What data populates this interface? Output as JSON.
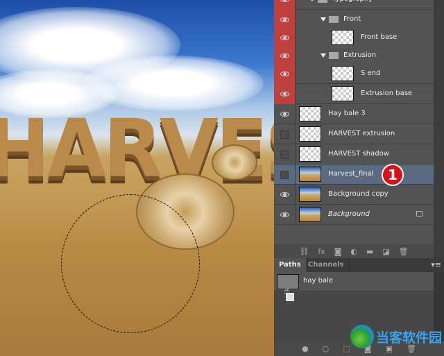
{
  "canvas": {
    "word": "HARVEST"
  },
  "layers": [
    {
      "name": "Typography",
      "type": "group",
      "visible": true,
      "highlight": "red",
      "indent": 1
    },
    {
      "name": "Front",
      "type": "group",
      "visible": true,
      "highlight": "red",
      "indent": 2
    },
    {
      "name": "Front base",
      "type": "layer",
      "visible": true,
      "highlight": "red",
      "indent": 3,
      "thumb": "transparent"
    },
    {
      "name": "Extrusion",
      "type": "group",
      "visible": true,
      "highlight": "red",
      "indent": 2
    },
    {
      "name": "S end",
      "type": "layer",
      "visible": true,
      "highlight": "red",
      "indent": 3,
      "thumb": "transparent"
    },
    {
      "name": "Extrusion base",
      "type": "layer",
      "visible": true,
      "highlight": "red",
      "indent": 3,
      "thumb": "transparent"
    },
    {
      "name": "Hay bale 3",
      "type": "layer",
      "visible": true,
      "indent": 0,
      "thumb": "transparent"
    },
    {
      "name": "HARVEST extrusion",
      "type": "layer",
      "visible": false,
      "indent": 0,
      "thumb": "transparent"
    },
    {
      "name": "HARVEST shadow",
      "type": "layer",
      "visible": false,
      "indent": 0,
      "thumb": "transparent"
    },
    {
      "name": "Harvest_final",
      "type": "smart",
      "visible": false,
      "indent": 0,
      "thumb": "photo",
      "selected": true
    },
    {
      "name": "Background copy",
      "type": "layer",
      "visible": true,
      "indent": 0,
      "thumb": "photo"
    },
    {
      "name": "Background",
      "type": "layer",
      "visible": true,
      "indent": 0,
      "thumb": "photo",
      "locked": true,
      "italic": true
    }
  ],
  "badge": "1",
  "layers_toolbar": [
    "link-icon",
    "fx",
    "mask-icon",
    "adjustment-icon",
    "folder-icon",
    "new-layer-icon",
    "trash-icon"
  ],
  "tabs": [
    {
      "label": "Paths",
      "active": true
    },
    {
      "label": "Channels",
      "active": false
    }
  ],
  "paths": [
    {
      "name": "hay bale"
    }
  ],
  "paths_toolbar": [
    "fill-path-icon",
    "stroke-path-icon",
    "selection-icon",
    "mask-icon",
    "new-path-icon",
    "trash-icon"
  ],
  "watermark": "当客软件园",
  "colors": {
    "highlight": "#c0403e",
    "selected": "#5a6a80",
    "badge": "#d8101a"
  }
}
